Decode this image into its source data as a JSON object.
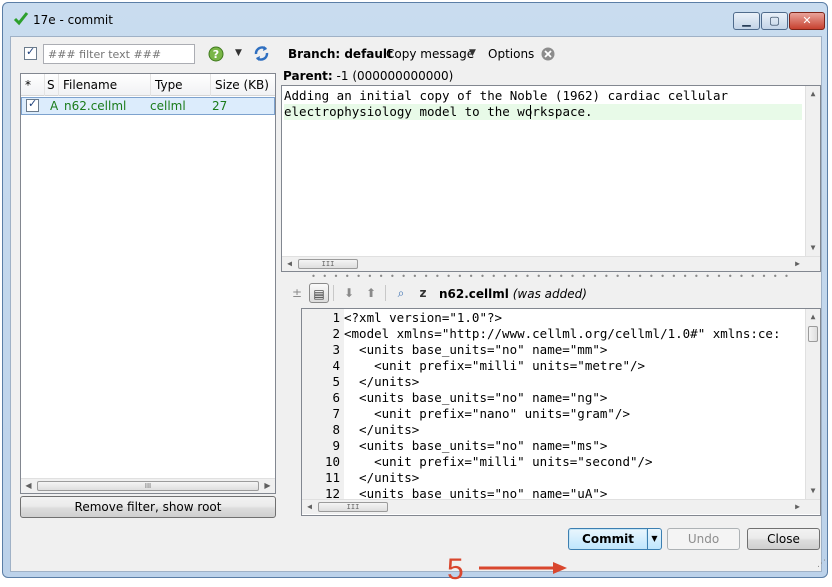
{
  "window": {
    "title": "17e - commit",
    "controls": {
      "minimize": "▁",
      "maximize": "▢",
      "close": "✕"
    }
  },
  "toolbar": {
    "filter_placeholder": "### filter text ###",
    "branch_label": "Branch: default",
    "copy_message_label": "Copy message",
    "options_label": "Options"
  },
  "file_list": {
    "columns": [
      "*",
      "S",
      "Filename",
      "Type",
      "Size (KB)"
    ],
    "rows": [
      {
        "status": "A",
        "filename": "n62.cellml",
        "type": "cellml",
        "size": "27"
      }
    ],
    "remove_filter_label": "Remove filter, show root"
  },
  "parent": {
    "label": "Parent:",
    "value": "-1 (000000000000)"
  },
  "commit_message": {
    "lines": [
      "Adding an initial copy of the Noble (1962) cardiac cellular",
      "electrophysiology model to the workspace."
    ]
  },
  "diff": {
    "filename": "n62.cellml",
    "status": "(was added)",
    "lines": [
      {
        "n": "1",
        "text": "<?xml version=\"1.0\"?>"
      },
      {
        "n": "2",
        "text": "<model xmlns=\"http://www.cellml.org/cellml/1.0#\" xmlns:ce:"
      },
      {
        "n": "3",
        "text": "  <units base_units=\"no\" name=\"mm\">"
      },
      {
        "n": "4",
        "text": "    <unit prefix=\"milli\" units=\"metre\"/>"
      },
      {
        "n": "5",
        "text": "  </units>"
      },
      {
        "n": "6",
        "text": "  <units base_units=\"no\" name=\"ng\">"
      },
      {
        "n": "7",
        "text": "    <unit prefix=\"nano\" units=\"gram\"/>"
      },
      {
        "n": "8",
        "text": "  </units>"
      },
      {
        "n": "9",
        "text": "  <units base_units=\"no\" name=\"ms\">"
      },
      {
        "n": "10",
        "text": "    <unit prefix=\"milli\" units=\"second\"/>"
      },
      {
        "n": "11",
        "text": "  </units>"
      },
      {
        "n": "12",
        "text": "  <units base_units=\"no\" name=\"uA\">"
      }
    ]
  },
  "buttons": {
    "commit": "Commit",
    "undo": "Undo",
    "close": "Close"
  },
  "annotation": {
    "number": "5"
  },
  "colors": {
    "added_text": "#1a7b1a",
    "annotation": "#d9472e",
    "current_line": "#e8fae8"
  },
  "icons": [
    "checkmark-icon",
    "filter-checkbox",
    "hg-settings-icon",
    "refresh-icon",
    "clear-options-icon",
    "diff-expand-icon",
    "diff-toggle-icon",
    "next-hunk-icon",
    "prev-hunk-icon",
    "diff-search-icon",
    "file-diff-icon"
  ]
}
